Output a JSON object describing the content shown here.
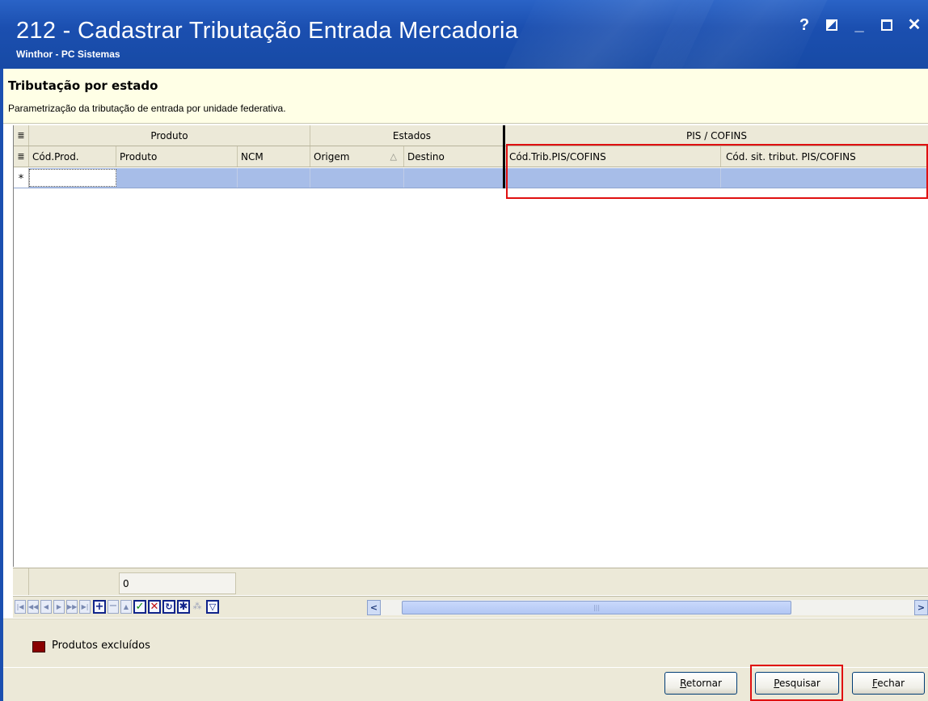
{
  "window": {
    "title": "212 - Cadastrar Tributação Entrada Mercadoria",
    "subtitle": "Winthor - PC Sistemas",
    "controls": {
      "help": "?",
      "minimize": "_",
      "close": "✕"
    }
  },
  "header": {
    "title": "Tributação por estado",
    "description": "Parametrização da tributação de entrada por unidade federativa."
  },
  "grid": {
    "bands": [
      "Produto",
      "Estados",
      "PIS / COFINS"
    ],
    "columns": [
      "Cód.Prod.",
      "Produto",
      "NCM",
      "Origem",
      "Destino",
      "Cód.Trib.PIS/COFINS",
      "Cód. sit. tribut. PIS/COFINS"
    ],
    "sort_indicator": "△",
    "new_row_marker": "*",
    "row_count": "0",
    "menu_glyph": "≣"
  },
  "navigator": {
    "buttons": [
      "first",
      "prev-page",
      "prev",
      "next",
      "next-page",
      "last",
      "insert",
      "delete",
      "edit",
      "post",
      "cancel",
      "refresh",
      "bookmark",
      "goto-bookmark",
      "filter"
    ],
    "scroll_left": "<",
    "scroll_right": ">",
    "scroll_thumb": "|||"
  },
  "legend": {
    "label": "Produtos excluídos",
    "color": "#8a0000"
  },
  "buttons": {
    "retornar": {
      "accel": "R",
      "rest": "etornar"
    },
    "pesquisar": {
      "accel": "P",
      "rest": "esquisar"
    },
    "fechar": {
      "accel": "F",
      "rest": "echar"
    }
  },
  "colors": {
    "titlebar": "#1b4fb0",
    "header_bg": "#ffffe6",
    "row_selected": "#a7bde8",
    "highlight": "#e01010"
  }
}
